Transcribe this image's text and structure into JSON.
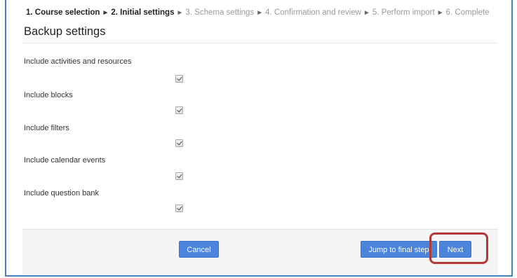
{
  "progress": {
    "steps": [
      {
        "label": "1. Course selection",
        "done": true
      },
      {
        "label": "2. Initial settings",
        "done": true
      },
      {
        "label": "3. Schema settings",
        "done": false
      },
      {
        "label": "4. Confirmation and review",
        "done": false
      },
      {
        "label": "5. Perform import",
        "done": false
      },
      {
        "label": "6. Complete",
        "done": false
      }
    ],
    "separator": "►"
  },
  "section": {
    "title": "Backup settings"
  },
  "settings": [
    {
      "label": "Include activities and resources",
      "checked": true
    },
    {
      "label": "Include blocks",
      "checked": true
    },
    {
      "label": "Include filters",
      "checked": true
    },
    {
      "label": "Include calendar events",
      "checked": true
    },
    {
      "label": "Include question bank",
      "checked": true
    }
  ],
  "footer": {
    "cancel_label": "Cancel",
    "jump_label": "Jump to final step",
    "next_label": "Next"
  },
  "colors": {
    "button": "#4a84db",
    "highlight": "#b23b36",
    "frame_border": "#4a7fc1"
  }
}
